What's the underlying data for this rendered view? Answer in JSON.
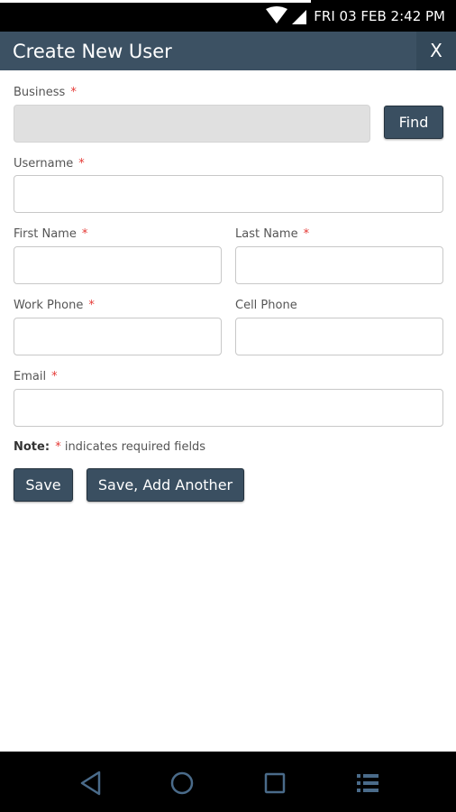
{
  "status_bar": {
    "time": "FRI 03 FEB 2:42 PM",
    "icons": [
      "wifi-icon",
      "cell-signal-icon"
    ]
  },
  "header": {
    "title": "Create New User",
    "close_label": "X"
  },
  "form": {
    "business": {
      "label": "Business",
      "required": "*",
      "value": "",
      "find_label": "Find"
    },
    "username": {
      "label": "Username",
      "required": "*",
      "value": ""
    },
    "first_name": {
      "label": "First Name",
      "required": "*",
      "value": ""
    },
    "last_name": {
      "label": "Last Name",
      "required": "*",
      "value": ""
    },
    "work_phone": {
      "label": "Work Phone",
      "required": "*",
      "value": ""
    },
    "cell_phone": {
      "label": "Cell Phone",
      "value": ""
    },
    "email": {
      "label": "Email",
      "required": "*",
      "value": ""
    },
    "note": {
      "prefix": "Note:",
      "star": "*",
      "text": "indicates required fields"
    },
    "save_label": "Save",
    "save_add_another_label": "Save, Add Another"
  },
  "nav_bar": {
    "icons": [
      "back-icon",
      "home-icon",
      "recents-icon",
      "menu-icon"
    ]
  },
  "colors": {
    "header_bg": "#3c5163",
    "button_bg": "#3a4f61",
    "required": "#e53935"
  }
}
